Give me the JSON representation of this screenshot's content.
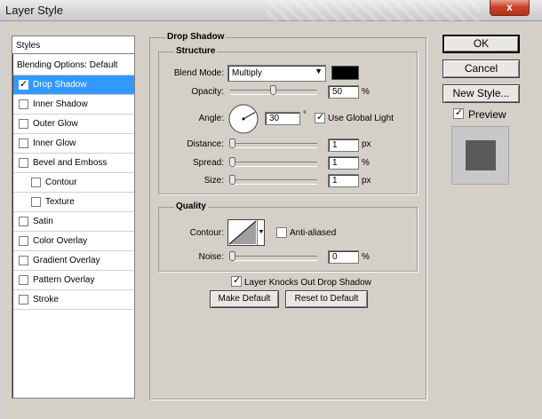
{
  "window": {
    "title": "Layer Style",
    "close_label": "x"
  },
  "styles_panel": {
    "header": "Styles",
    "items": [
      {
        "label": "Blending Options: Default",
        "has_checkbox": false,
        "checked": false,
        "selected": false,
        "indent": false
      },
      {
        "label": "Drop Shadow",
        "has_checkbox": true,
        "checked": true,
        "selected": true,
        "indent": false
      },
      {
        "label": "Inner Shadow",
        "has_checkbox": true,
        "checked": false,
        "selected": false,
        "indent": false
      },
      {
        "label": "Outer Glow",
        "has_checkbox": true,
        "checked": false,
        "selected": false,
        "indent": false
      },
      {
        "label": "Inner Glow",
        "has_checkbox": true,
        "checked": false,
        "selected": false,
        "indent": false
      },
      {
        "label": "Bevel and Emboss",
        "has_checkbox": true,
        "checked": false,
        "selected": false,
        "indent": false
      },
      {
        "label": "Contour",
        "has_checkbox": true,
        "checked": false,
        "selected": false,
        "indent": true
      },
      {
        "label": "Texture",
        "has_checkbox": true,
        "checked": false,
        "selected": false,
        "indent": true
      },
      {
        "label": "Satin",
        "has_checkbox": true,
        "checked": false,
        "selected": false,
        "indent": false
      },
      {
        "label": "Color Overlay",
        "has_checkbox": true,
        "checked": false,
        "selected": false,
        "indent": false
      },
      {
        "label": "Gradient Overlay",
        "has_checkbox": true,
        "checked": false,
        "selected": false,
        "indent": false
      },
      {
        "label": "Pattern Overlay",
        "has_checkbox": true,
        "checked": false,
        "selected": false,
        "indent": false
      },
      {
        "label": "Stroke",
        "has_checkbox": true,
        "checked": false,
        "selected": false,
        "indent": false
      }
    ]
  },
  "drop_shadow": {
    "title": "Drop Shadow",
    "structure": {
      "title": "Structure",
      "blend_mode_label": "Blend Mode:",
      "blend_mode_value": "Multiply",
      "shadow_color": "#000000",
      "opacity_label": "Opacity:",
      "opacity_value": "50",
      "opacity_unit": "%",
      "opacity_level": 50,
      "angle_label": "Angle:",
      "angle_value": "30",
      "angle_unit": "°",
      "angle_degrees": 30,
      "global_light_label": "Use Global Light",
      "global_light_checked": true,
      "distance_label": "Distance:",
      "distance_value": "1",
      "distance_unit": "px",
      "spread_label": "Spread:",
      "spread_value": "1",
      "spread_unit": "%",
      "size_label": "Size:",
      "size_value": "1",
      "size_unit": "px"
    },
    "quality": {
      "title": "Quality",
      "contour_label": "Contour:",
      "anti_aliased_label": "Anti-aliased",
      "anti_aliased_checked": false,
      "noise_label": "Noise:",
      "noise_value": "0",
      "noise_unit": "%"
    },
    "knockout_label": "Layer Knocks Out Drop Shadow",
    "knockout_checked": true,
    "make_default_label": "Make Default",
    "reset_default_label": "Reset to Default"
  },
  "actions": {
    "ok_label": "OK",
    "cancel_label": "Cancel",
    "new_style_label": "New Style...",
    "preview_label": "Preview",
    "preview_checked": true
  },
  "colors": {
    "selection": "#3399ff",
    "preview_bg": "#c8c8c8",
    "preview_swatch": "#5a5a5a"
  }
}
